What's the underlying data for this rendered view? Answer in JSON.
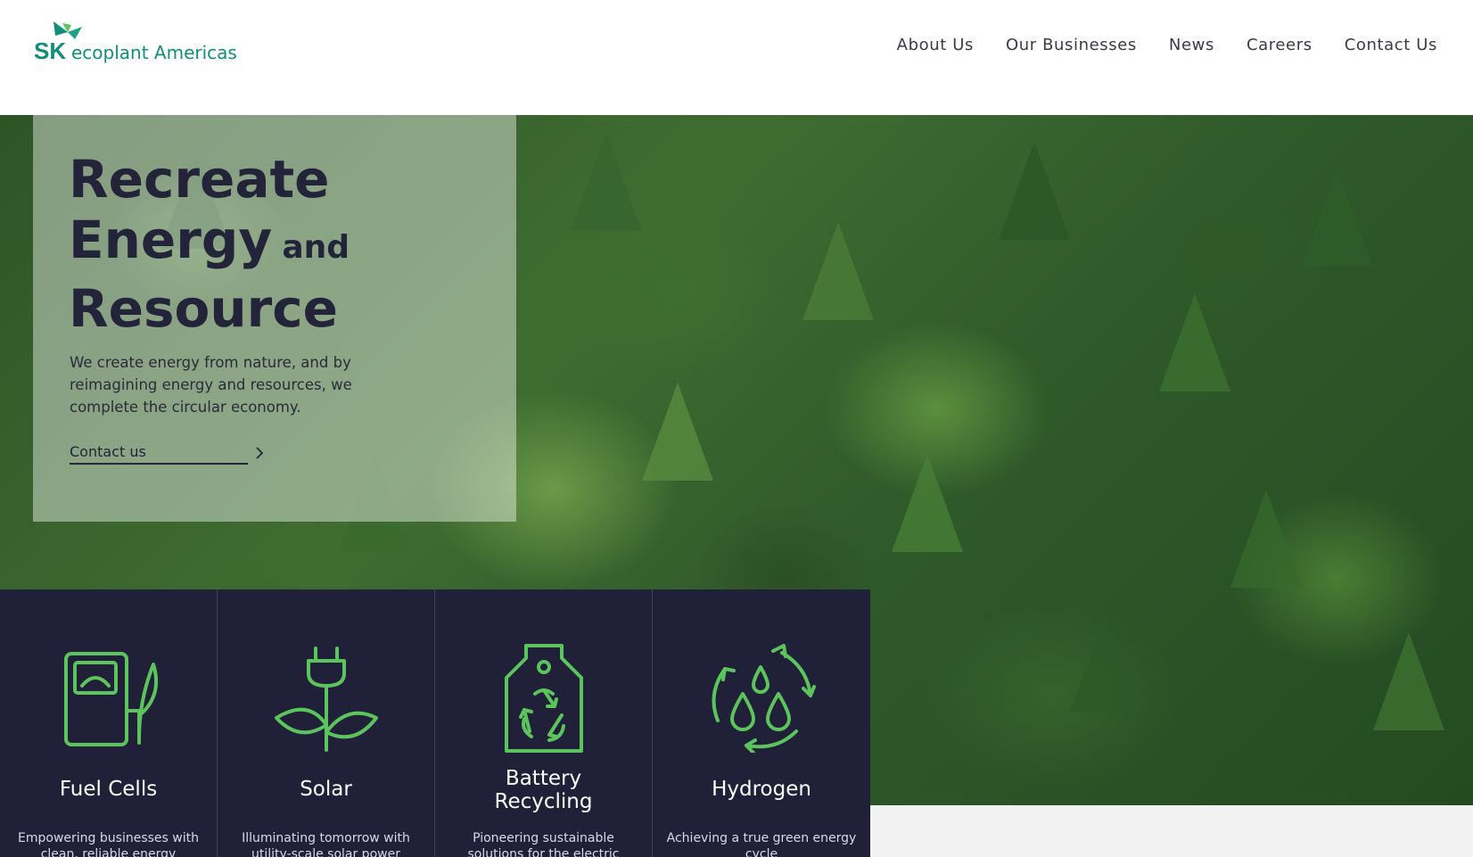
{
  "header": {
    "logo": {
      "sk": "SK",
      "name": "ecoplant Americas",
      "color": "#0f8f7a"
    },
    "nav": [
      {
        "label": "About Us"
      },
      {
        "label": "Our Businesses"
      },
      {
        "label": "News"
      },
      {
        "label": "Careers"
      },
      {
        "label": "Contact Us"
      }
    ]
  },
  "hero": {
    "title_line1": "Recreate",
    "title_line2_main": "Energy",
    "title_line2_small": "and",
    "title_line3": "Resource",
    "text": "We create energy from nature, and by reimagining energy and resources, we complete the circular economy.",
    "cta_label": "Contact us",
    "cta_icon": "chevron-right-icon",
    "background": "forest-canopy-image"
  },
  "services": {
    "accent_color": "#5cc45c",
    "background_color": "#202039",
    "items": [
      {
        "title": "Fuel Cells",
        "desc": "Empowering businesses with clean, reliable energy",
        "icon": "fuel-cell-icon"
      },
      {
        "title": "Solar",
        "desc": "Illuminating tomorrow with utility-scale solar power",
        "icon": "solar-plug-leaf-icon"
      },
      {
        "title": "Battery Recycling",
        "title_line1": "Battery",
        "title_line2": "Recycling",
        "desc": "Pioneering sustainable solutions for the electric revolution",
        "icon": "battery-recycle-icon"
      },
      {
        "title": "Hydrogen",
        "desc": "Achieving a true green energy cycle",
        "icon": "hydrogen-cycle-icon"
      }
    ]
  }
}
